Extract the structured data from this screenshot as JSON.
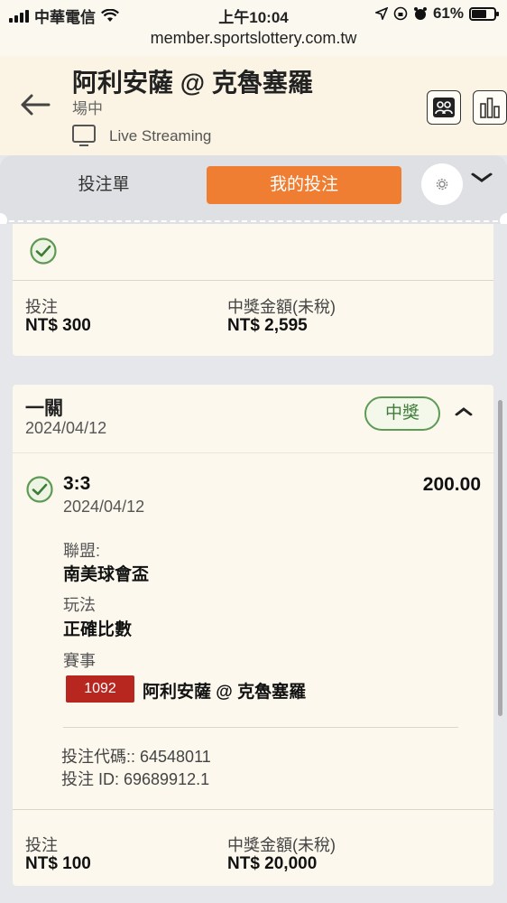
{
  "status_bar": {
    "carrier": "中華電信",
    "time": "上午10:04",
    "battery": "61%"
  },
  "browser": {
    "url": "member.sportslottery.com.tw"
  },
  "header": {
    "title": "阿利安薩 @ 克魯塞羅",
    "status": "場中",
    "live_streaming": "Live Streaming"
  },
  "tabs": {
    "betslip": "投注單",
    "my_bets": "我的投注"
  },
  "previous_bet": {
    "stake_label": "投注",
    "stake_value": "NT$ 300",
    "payout_label": "中獎金額(未稅)",
    "payout_value": "NT$ 2,595"
  },
  "bet": {
    "type": "一關",
    "date": "2024/04/12",
    "result_badge": "中獎",
    "selection": {
      "score": "3:3",
      "date": "2024/04/12",
      "odds": "200.00"
    },
    "league_label": "聯盟:",
    "league_value": "南美球會盃",
    "market_label": "玩法",
    "market_value": "正確比數",
    "event_label": "賽事",
    "event_code": "1092",
    "event_name": "阿利安薩 @ 克魯塞羅",
    "bet_code": "投注代碼:: 64548011",
    "bet_id": "投注 ID: 69689912.1",
    "stake_label": "投注",
    "stake_value": "NT$ 100",
    "payout_label": "中獎金額(未稅)",
    "payout_value": "NT$ 20,000"
  },
  "colors": {
    "accent_orange": "#ef7e32",
    "win_green": "#3f7c39",
    "event_red": "#b8271f",
    "card_bg": "#fcf8ee"
  },
  "icons": [
    "wifi-icon",
    "location-icon",
    "alarm-icon",
    "back-arrow-icon",
    "tv-icon",
    "lineup-icon",
    "stats-icon",
    "gear-icon",
    "chevron-down-icon",
    "chevron-up-icon",
    "check-circle-icon"
  ]
}
